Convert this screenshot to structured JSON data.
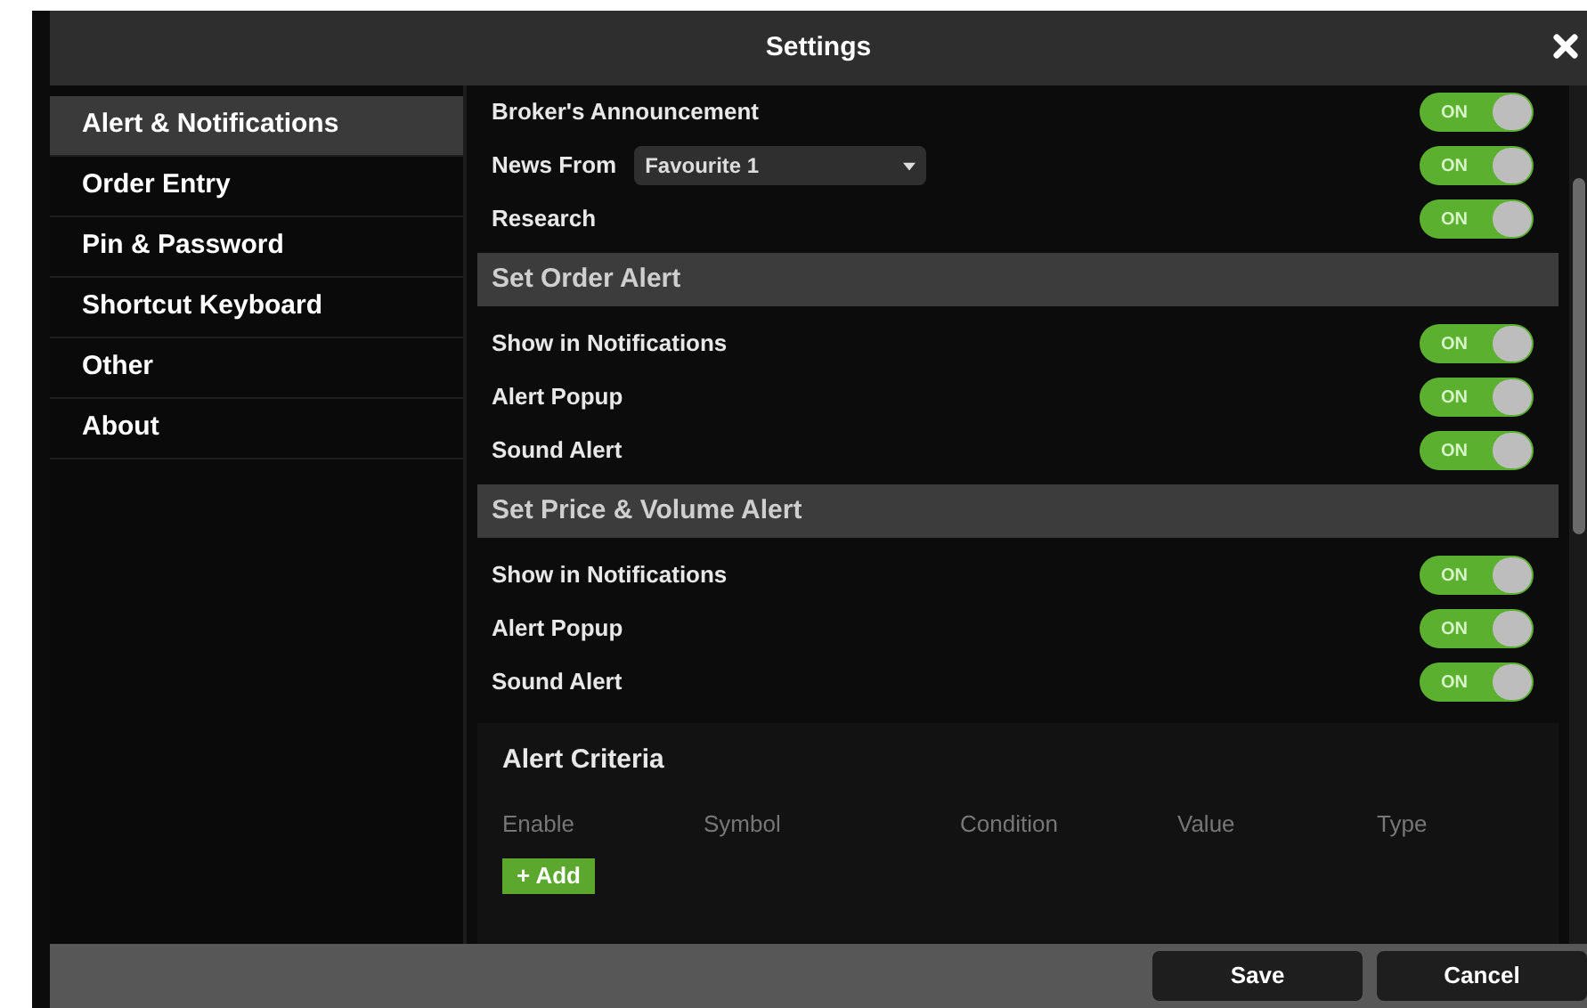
{
  "window": {
    "title": "Settings"
  },
  "sidebar": {
    "items": [
      {
        "label": "Alert & Notifications",
        "selected": true
      },
      {
        "label": "Order Entry",
        "selected": false
      },
      {
        "label": "Pin & Password",
        "selected": false
      },
      {
        "label": "Shortcut Keyboard",
        "selected": false
      },
      {
        "label": "Other",
        "selected": false
      },
      {
        "label": "About",
        "selected": false
      }
    ]
  },
  "sections": [
    {
      "rows": [
        {
          "kind": "toggle",
          "label": "Broker's Announcement",
          "toggle": {
            "on": true,
            "label": "ON"
          }
        },
        {
          "kind": "dropdown",
          "label": "News From",
          "value": "Favourite 1",
          "toggle": {
            "on": true,
            "label": "ON"
          }
        },
        {
          "kind": "toggle",
          "label": "Research",
          "toggle": {
            "on": true,
            "label": "ON"
          }
        }
      ]
    },
    {
      "title": "Set Order Alert",
      "rows": [
        {
          "kind": "toggle",
          "label": "Show in Notifications",
          "toggle": {
            "on": true,
            "label": "ON"
          }
        },
        {
          "kind": "toggle",
          "label": "Alert Popup",
          "toggle": {
            "on": true,
            "label": "ON"
          }
        },
        {
          "kind": "toggle",
          "label": "Sound Alert",
          "toggle": {
            "on": true,
            "label": "ON"
          }
        }
      ]
    },
    {
      "title": "Set Price & Volume Alert",
      "rows": [
        {
          "kind": "toggle",
          "label": "Show in Notifications",
          "toggle": {
            "on": true,
            "label": "ON"
          }
        },
        {
          "kind": "toggle",
          "label": "Alert Popup",
          "toggle": {
            "on": true,
            "label": "ON"
          }
        },
        {
          "kind": "toggle",
          "label": "Sound Alert",
          "toggle": {
            "on": true,
            "label": "ON"
          }
        }
      ]
    }
  ],
  "alert_criteria": {
    "title": "Alert Criteria",
    "columns": [
      "Enable",
      "Symbol",
      "Condition",
      "Value",
      "Type"
    ],
    "add_button": "+ Add"
  },
  "footer": {
    "buttons": [
      "Save",
      "Cancel"
    ]
  }
}
